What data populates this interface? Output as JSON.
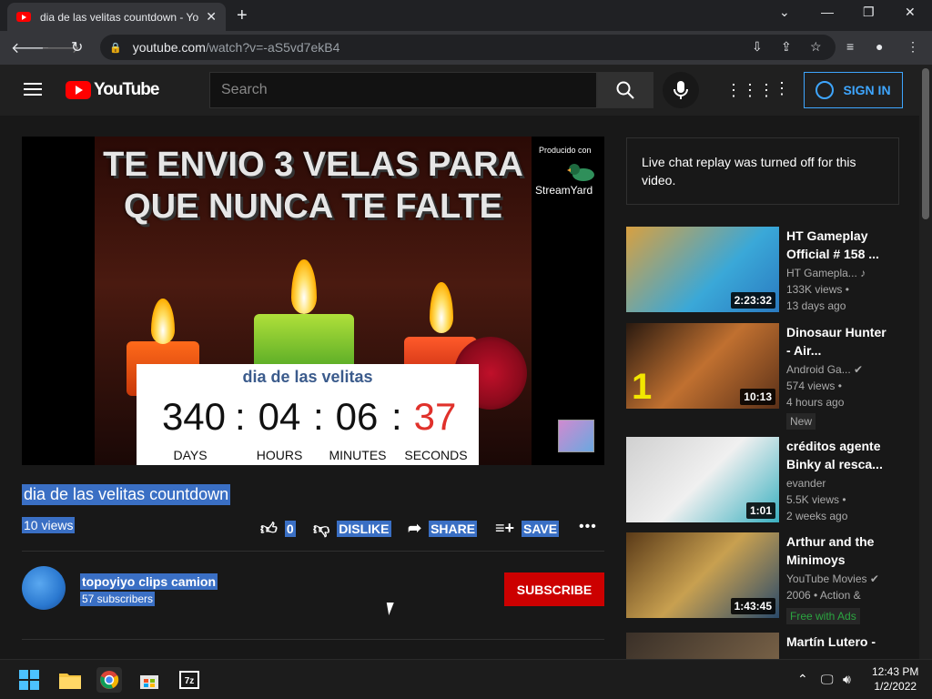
{
  "browser": {
    "tab_title": "dia de las velitas countdown - Yo",
    "tab_close": "✕",
    "new_tab": "+",
    "url_host": "youtube.com",
    "url_path": "/watch?v=-aS5vd7ekB4"
  },
  "youtube": {
    "logo_text": "YouTube",
    "search_placeholder": "Search",
    "sign_in": "SIGN IN"
  },
  "video": {
    "overlay_title": "TE ENVIO 3 VELAS PARA QUE NUNCA TE FALTE",
    "produced_by": "Producido con",
    "producer_brand": "StreamYard",
    "countdown_title": "dia de las velitas",
    "countdown": [
      {
        "value": "340",
        "unit": "DAYS",
        "color": "#111111"
      },
      {
        "value": "04",
        "unit": "HOURS",
        "color": "#111111"
      },
      {
        "value": "06",
        "unit": "MINUTES",
        "color": "#111111"
      },
      {
        "value": "37",
        "unit": "SECONDS",
        "color": "#e0312b"
      }
    ],
    "separator": ":",
    "title": "dia de las velitas countdown",
    "views": "10 views",
    "like_count": "0",
    "dislike": "DISLIKE",
    "share": "SHARE",
    "save": "SAVE"
  },
  "channel": {
    "name": "topoyiyo clips camion",
    "subscribers": "57 subscribers",
    "subscribe": "SUBSCRIBE"
  },
  "sidebar": {
    "live_chat": "Live chat replay was turned off for this video.",
    "recommendations": [
      {
        "title": "HT Gameplay Official # 158 ...",
        "channel": "HT Gamepla... ♪",
        "views": "133K views •",
        "age": "13 days ago",
        "duration": "2:23:32",
        "badge": ""
      },
      {
        "title": "Dinosaur Hunter - Air...",
        "channel": "Android Ga... ✔",
        "views": "574 views •",
        "age": "4 hours ago",
        "duration": "10:13",
        "badge": "New"
      },
      {
        "title": "créditos agente Binky al resca...",
        "channel": "evander",
        "views": "5.5K views •",
        "age": "2 weeks ago",
        "duration": "1:01",
        "badge": ""
      },
      {
        "title": "Arthur and the Minimoys",
        "channel": "YouTube Movies ✔",
        "views": "2006 • Action &",
        "age": "",
        "duration": "1:43:45",
        "badge": "Free with Ads"
      },
      {
        "title": "Martín Lutero - ...",
        "channel": "",
        "views": "",
        "age": "",
        "duration": "",
        "badge": ""
      }
    ]
  },
  "taskbar": {
    "time": "12:43 PM",
    "date": "1/2/2022"
  },
  "colors": {
    "accent_blue": "#3ea6ff",
    "subscribe_red": "#cc0000",
    "selection": "#3a6fc4"
  }
}
